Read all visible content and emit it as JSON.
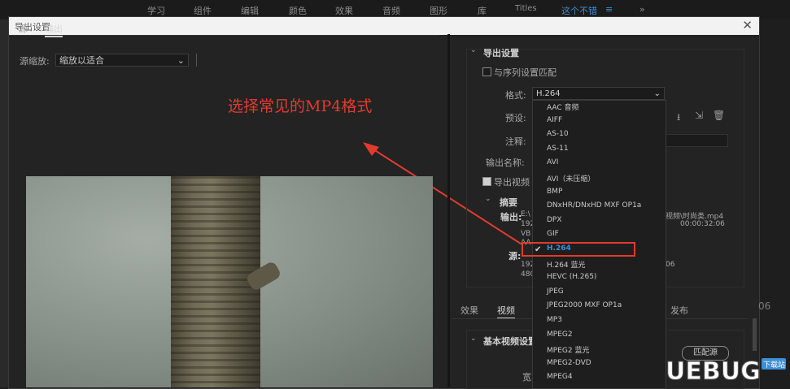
{
  "topbar": {
    "items": [
      "学习",
      "组件",
      "编辑",
      "颜色",
      "效果",
      "音频",
      "图形",
      "库",
      "Titles"
    ],
    "active": "这个不错",
    "active_suffix": "≡",
    "more": "»"
  },
  "dialog": {
    "title": "导出设置",
    "close": "✕"
  },
  "left_pane": {
    "tabs": [
      "源",
      "输出"
    ],
    "source_scale_label": "源缩放:",
    "source_scale_value": "缩放以适合",
    "annotation": "选择常见的MP4格式"
  },
  "export_settings": {
    "header": "导出设置",
    "match_sequence": "与序列设置匹配",
    "format_label": "格式:",
    "format_value": "H.264",
    "preset_label": "预设:",
    "comment_label": "注释:",
    "output_name_label": "输出名称:",
    "export_video": "导出视频",
    "summary_header": "摘要",
    "output_label": "输出:",
    "source_label": "源:",
    "summary_lines": {
      "out1": "E:\\",
      "out_file": "视频\\时尚类.mp4",
      "out2": "192",
      "out_dur": "00:00:32:06",
      "out3": "VB",
      "out4": "AA",
      "src1": "192",
      "src_tail": "06",
      "src2": "480"
    },
    "format_options": [
      "AAC 音频",
      "AIFF",
      "AS-10",
      "AS-11",
      "AVI",
      "AVI（未压缩）",
      "BMP",
      "DNxHR/DNxHD MXF OP1a",
      "DPX",
      "GIF",
      "H.264",
      "H.264 蓝光",
      "HEVC (H.265)",
      "JPEG",
      "JPEG2000 MXF OP1a",
      "MP3",
      "MPEG2",
      "MPEG2 蓝光",
      "MPEG2-DVD",
      "MPEG4"
    ],
    "selected_index": 10
  },
  "bottom_tabs": [
    "效果",
    "视频",
    "发布"
  ],
  "basic_video": {
    "header": "基本视频设置",
    "match_source": "匹配源",
    "width_label": "宽"
  },
  "right_edge_text": "06",
  "watermark": {
    "logo": "UEBUG",
    "sub": "下载站"
  }
}
